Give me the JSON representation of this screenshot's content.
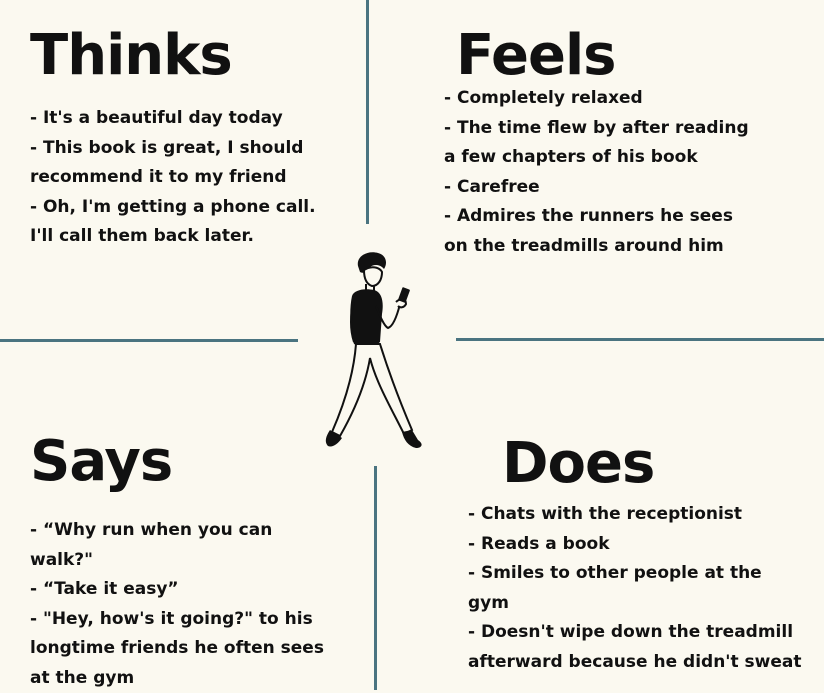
{
  "thinks": {
    "title": "Thinks",
    "items": [
      "- It's a beautiful day today",
      "- This book is great, I should recommend it to my friend",
      "- Oh, I'm getting a phone call. I'll call them back later."
    ]
  },
  "feels": {
    "title": "Feels",
    "items": [
      "- Completely relaxed",
      "- The time flew by after reading a few chapters of his book",
      "- Carefree",
      "- Admires the runners he sees on the treadmills around him"
    ]
  },
  "says": {
    "title": "Says",
    "items": [
      "- “Why run when you can walk?\"",
      "- “Take it easy”",
      "- \"Hey, how's it going?\" to his longtime friends he often sees at the gym"
    ]
  },
  "does": {
    "title": "Does",
    "items": [
      "- Chats with the receptionist",
      "- Reads a book",
      "- Smiles to other people at the gym",
      "- Doesn't wipe down the treadmill afterward because he didn't sweat"
    ]
  },
  "colors": {
    "background": "#fbf9f0",
    "divider": "#4a7480",
    "text": "#111111"
  },
  "icons": {
    "center_figure": "walking-person-reading-phone-icon"
  }
}
